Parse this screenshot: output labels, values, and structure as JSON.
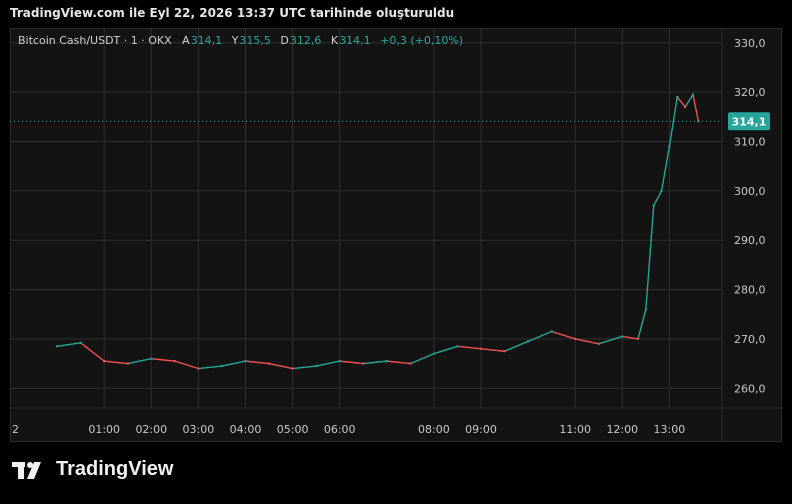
{
  "header": {
    "title": "TradingView.com ile Eyl 22, 2026 13:37 UTC tarihinde oluşturuldu"
  },
  "legend": {
    "symbol": "Bitcoin Cash/USDT · 1 · OKX",
    "open_label": "A",
    "open": "314,1",
    "high_label": "Y",
    "high": "315,5",
    "low_label": "D",
    "low": "312,6",
    "close_label": "K",
    "close": "314,1",
    "change": "+0,3 (+0,10%)"
  },
  "footer": {
    "brand": "TradingView"
  },
  "colors": {
    "up": "#26a69a",
    "down": "#ef5350",
    "accent": "#26a69a",
    "grid": "#2f2f2f",
    "background": "#131313"
  },
  "chart_data": {
    "type": "line",
    "title": "",
    "xlabel": "",
    "ylabel": "",
    "ylim": [
      256,
      333
    ],
    "y_ticks": [
      "330,0",
      "320,0",
      "310,0",
      "300,0",
      "290,0",
      "280,0",
      "270,0",
      "260,0"
    ],
    "y_tick_values": [
      330,
      320,
      310,
      300,
      290,
      280,
      270,
      260
    ],
    "x_ticks": [
      "2",
      "01:00",
      "02:00",
      "03:00",
      "04:00",
      "05:00",
      "06:00",
      "08:00",
      "09:00",
      "11:00",
      "12:00",
      "13:00"
    ],
    "last_price_label": "314,1",
    "last_price": 314.1,
    "grid": true,
    "series": [
      {
        "x": [
          "00:00",
          "00:30",
          "01:00",
          "01:30",
          "02:00",
          "02:30",
          "03:00",
          "03:30",
          "04:00",
          "04:30",
          "05:00",
          "05:30",
          "06:00",
          "06:30",
          "07:00",
          "07:30",
          "08:00",
          "08:30",
          "09:00",
          "09:30",
          "10:00",
          "10:30",
          "11:00",
          "11:30",
          "12:00",
          "12:20",
          "12:30",
          "12:40",
          "12:50",
          "13:00",
          "13:10",
          "13:20",
          "13:30",
          "13:37"
        ],
        "values": [
          268.5,
          269.2,
          265.5,
          265.0,
          266.0,
          265.5,
          264.0,
          264.5,
          265.5,
          265.0,
          264.0,
          264.5,
          265.5,
          265.0,
          265.5,
          265.0,
          267.0,
          268.5,
          268.0,
          267.5,
          269.5,
          271.5,
          270.0,
          269.0,
          270.5,
          270.0,
          276.0,
          297.0,
          300.0,
          309.0,
          319.0,
          317.0,
          319.5,
          314.1
        ]
      }
    ]
  }
}
